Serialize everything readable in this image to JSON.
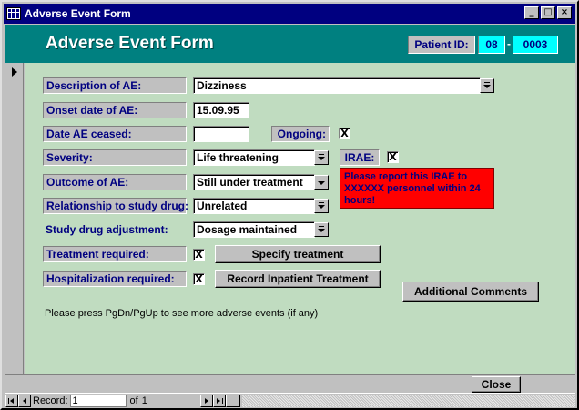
{
  "window": {
    "title": "Adverse Event Form",
    "buttons": {
      "minimize": "_",
      "maximize": "□",
      "close": "×"
    }
  },
  "header": {
    "form_title": "Adverse Event Form",
    "patient_id_label": "Patient ID:",
    "patient_site": "08",
    "patient_separator": "-",
    "patient_number": "0003",
    "color": "#008080"
  },
  "form": {
    "background": "#c0dcc0",
    "description": {
      "label": "Description of AE:",
      "value": "Dizziness"
    },
    "onset_date": {
      "label": "Onset date of AE:",
      "value": "15.09.95"
    },
    "date_ceased": {
      "label": "Date AE ceased:",
      "value": ""
    },
    "ongoing": {
      "label": "Ongoing:",
      "checked": "X"
    },
    "severity": {
      "label": "Severity:",
      "value": "Life threatening"
    },
    "irae": {
      "label": "IRAE:",
      "checked": "X"
    },
    "outcome": {
      "label": "Outcome of AE:",
      "value": "Still under treatment"
    },
    "warning": {
      "text": "Please report this IRAE to XXXXXX personnel within 24 hours!",
      "color": "#ff0000"
    },
    "relationship": {
      "label": "Relationship to study drug:",
      "value": "Unrelated"
    },
    "adjustment": {
      "label": "Study drug adjustment:",
      "value": "Dosage maintained"
    },
    "treatment": {
      "label": "Treatment required:",
      "checked": "X",
      "button": "Specify treatment"
    },
    "hospitalization": {
      "label": "Hospitalization required:",
      "checked": "X",
      "button": "Record Inpatient Treatment"
    },
    "additional_comments_button": "Additional Comments",
    "hint": "Please press PgDn/PgUp to see more adverse events (if any)"
  },
  "footer": {
    "close_button": "Close"
  },
  "navigation": {
    "record_label": "Record:",
    "record_value": "1",
    "of_label": "of",
    "total": "1"
  }
}
